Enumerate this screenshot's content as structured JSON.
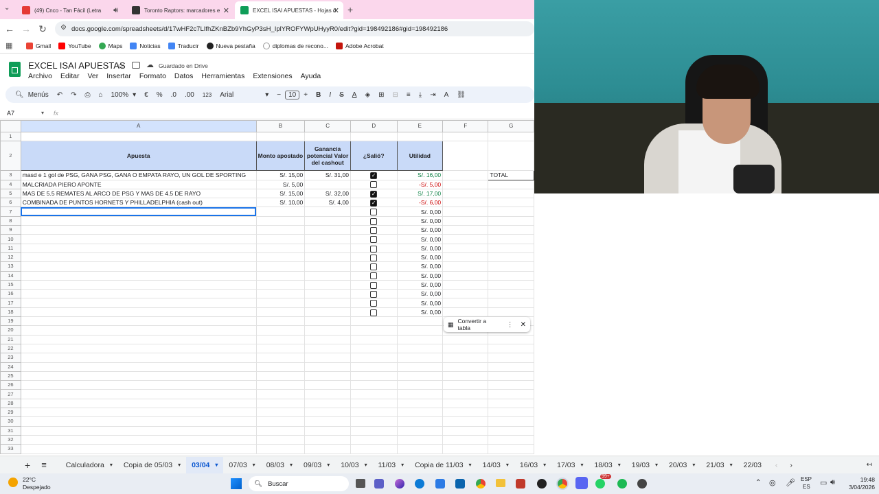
{
  "browser": {
    "tabs": [
      {
        "title": "(49) Cnco - Tan Fácil (Letra",
        "icon": "youtube-icon",
        "color": "#e53935"
      },
      {
        "title": "Toronto Raptors: marcadores e",
        "icon": "news-icon",
        "color": "#333333"
      },
      {
        "title": "EXCEL ISAI APUESTAS - Hojas d",
        "icon": "sheets-icon",
        "color": "#0f9d58"
      }
    ],
    "url": "docs.google.com/spreadsheets/d/17wHF2c7LIfhZKnBZb9YhGyP3sH_IplYROFYWpUHyyR0/edit?gid=198492186#gid=198492186",
    "bookmarks": [
      "Gmail",
      "YouTube",
      "Maps",
      "Noticias",
      "Traducir",
      "Nueva pestaña",
      "diplomas de recono...",
      "Adobe Acrobat"
    ]
  },
  "doc": {
    "title": "EXCEL ISAI APUESTAS",
    "saved_status": "Guardado en Drive",
    "menus": [
      "Archivo",
      "Editar",
      "Ver",
      "Insertar",
      "Formato",
      "Datos",
      "Herramientas",
      "Extensiones",
      "Ayuda"
    ]
  },
  "toolbar": {
    "search": "Menús",
    "zoom": "100%",
    "currency": "€",
    "percent": "%",
    "dec_less": ".0",
    "dec_more": ".00",
    "number_format": "123",
    "font": "Arial",
    "font_size": "10"
  },
  "formula_bar": {
    "cell_ref": "A7",
    "fx": "fx",
    "value": ""
  },
  "sheet": {
    "columns": [
      "A",
      "B",
      "C",
      "D",
      "E",
      "F",
      "G"
    ],
    "headers": {
      "apuesta": "Apuesta",
      "monto": "Monto apostado",
      "ganancia": "Ganancia potencial Valor del cashout",
      "salio": "¿Salió?",
      "utilidad": "Utilidad"
    },
    "total_label": "TOTAL",
    "rows": [
      {
        "num": "3",
        "apuesta": "masd e 1 gol de PSG, GANA PSG, GANA O EMPATA RAYO, UN GOL DE SPORTING",
        "monto": "S/. 15,00",
        "ganancia": "S/. 31,00",
        "checked": true,
        "utilidad": "S/. 16,00",
        "color": "green"
      },
      {
        "num": "4",
        "apuesta": "MALCRIADA PIERO APONTE",
        "monto": "S/. 5,00",
        "ganancia": "",
        "checked": false,
        "utilidad": "-S/. 5,00",
        "color": "red"
      },
      {
        "num": "5",
        "apuesta": "MAS DE 5.5 REMATES AL ARCO DE PSG Y MAS DE 4.5 DE RAYO",
        "monto": "S/. 15,00",
        "ganancia": "S/. 32,00",
        "checked": true,
        "utilidad": "S/. 17,00",
        "color": "green"
      },
      {
        "num": "6",
        "apuesta": "COMBINADA DE PUNTOS HORNETS Y PHILLADELPHIA (cash out)",
        "monto": "S/. 10,00",
        "ganancia": "S/. 4,00",
        "checked": true,
        "utilidad": "-S/. 6,00",
        "color": "red"
      }
    ],
    "empty_utilidad": "S/. 0,00",
    "convert_popup": "Convertir a tabla"
  },
  "sheet_tabs": [
    "Calculadora",
    "Copia de 05/03",
    "03/04",
    "07/03",
    "08/03",
    "09/03",
    "10/03",
    "11/03",
    "Copia de 11/03",
    "14/03",
    "16/03",
    "17/03",
    "18/03",
    "19/03",
    "20/03",
    "21/03",
    "22/03"
  ],
  "active_sheet_tab": "03/04",
  "taskbar": {
    "weather_temp": "22°C",
    "weather_desc": "Despejado",
    "search": "Buscar",
    "lang": "ESP",
    "lang_sub": "ES",
    "time": "19:48",
    "date": "3/04/2026",
    "badge": "99+"
  }
}
